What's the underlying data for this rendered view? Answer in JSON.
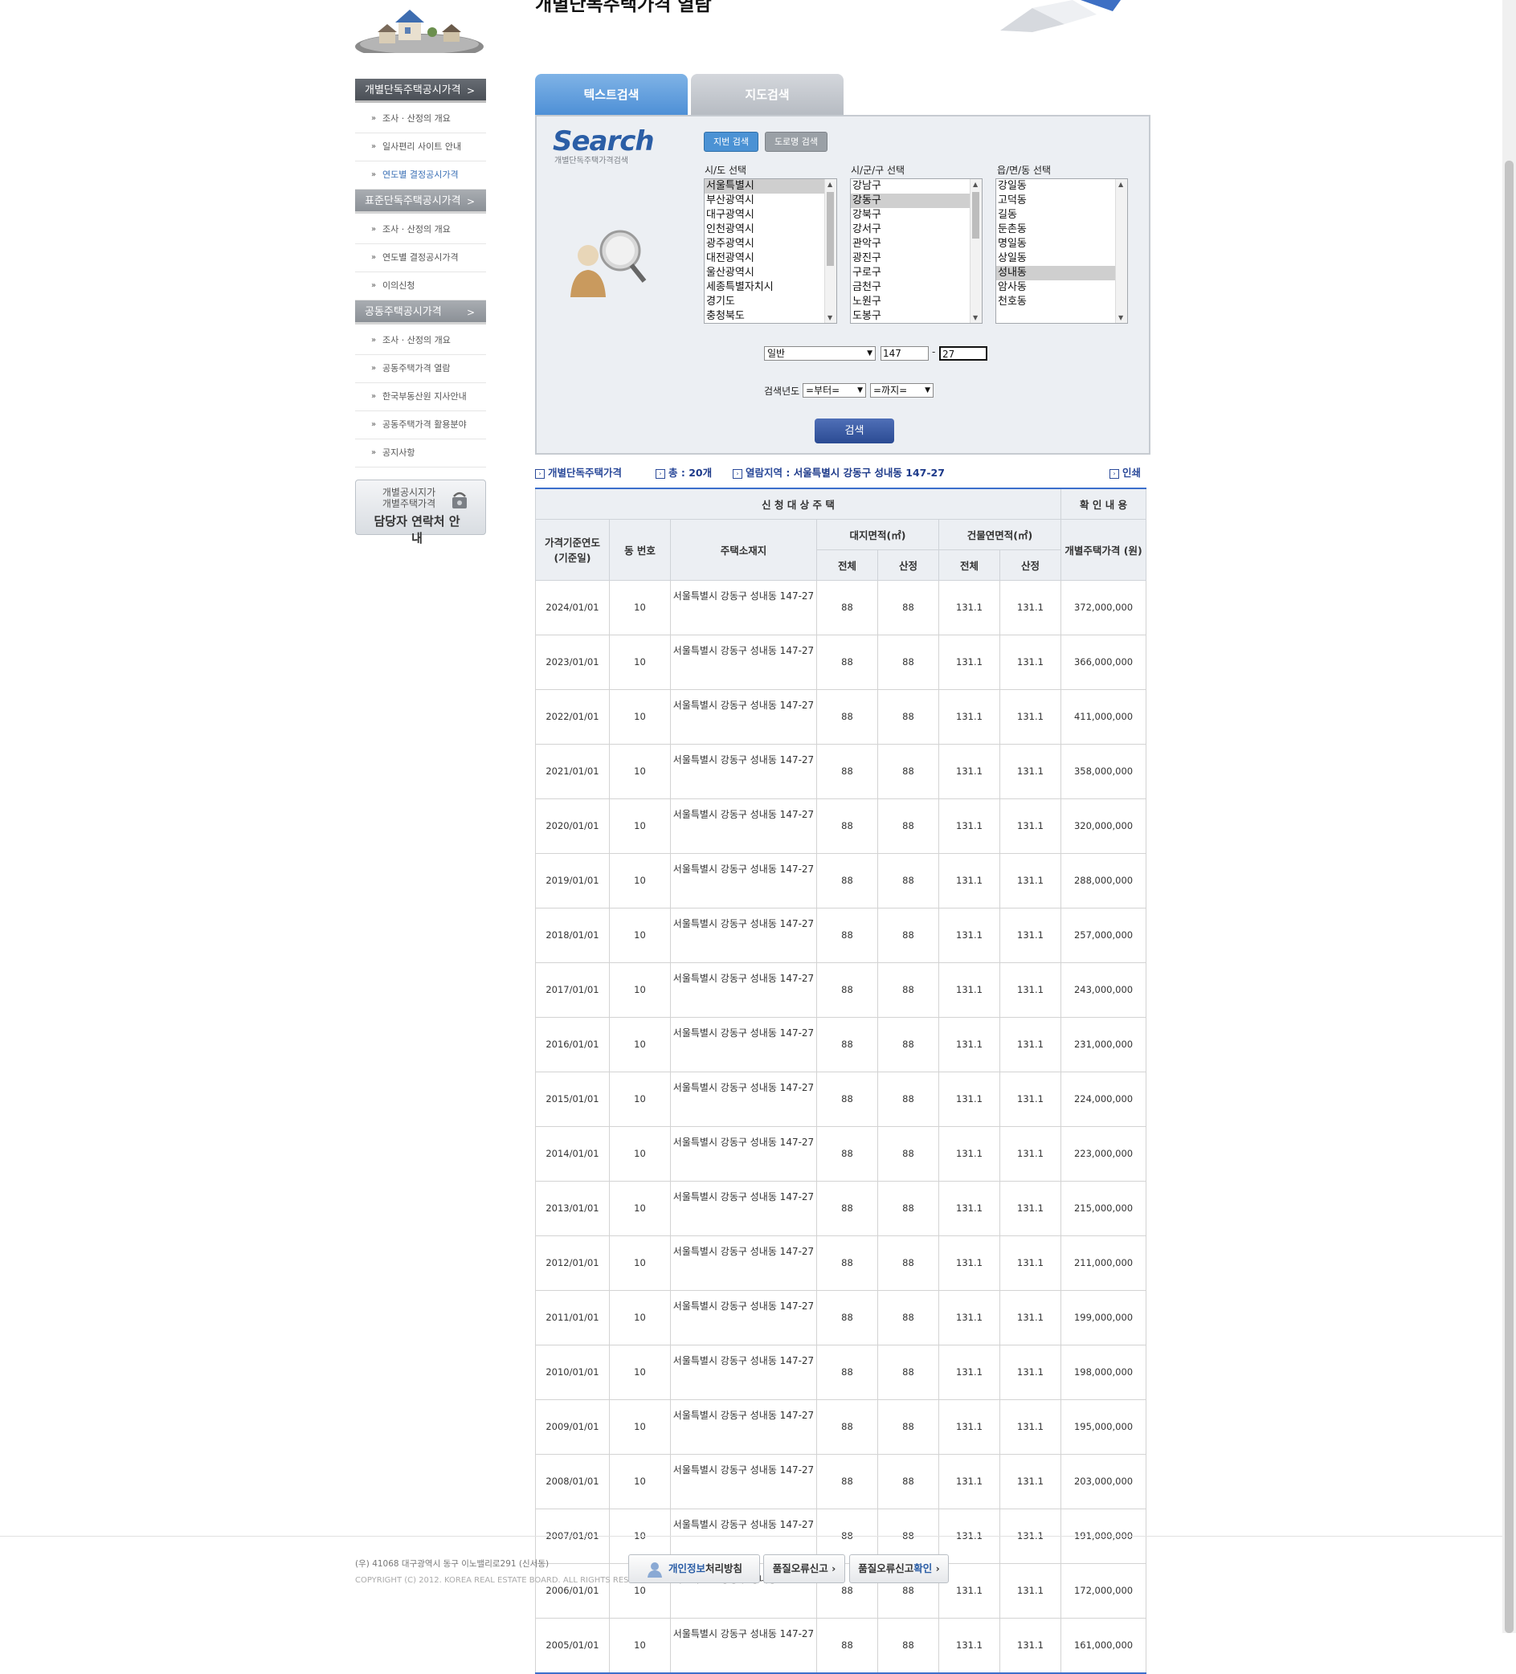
{
  "header": {
    "title": "개별단독주택가격 열람"
  },
  "lnb": {
    "groups": [
      {
        "title": "개별단독주택공시가격",
        "chev": ">",
        "items": [
          "조사 · 산정의 개요",
          "일사편리 사이트 안내",
          "연도별 결정공시가격"
        ]
      },
      {
        "title": "표준단독주택공시가격",
        "chev": ">",
        "items": [
          "조사 · 산정의 개요",
          "연도별 결정공시가격",
          "이의신청"
        ]
      },
      {
        "title": "공동주택공시가격",
        "chev": ">",
        "items": [
          "조사 · 산정의 개요",
          "공동주택가격 열람",
          "한국부동산원 지사안내",
          "공동주택가격 활용분야",
          "공지사항"
        ]
      }
    ],
    "bullet": "»",
    "contact": {
      "line1": "개별공시지가",
      "line2": "개별주택가격",
      "line3": "담당자 연락처 안내"
    }
  },
  "tabs": {
    "text_search": "텍스트검색",
    "map_search": "지도검색"
  },
  "search": {
    "logo": "Search",
    "logo_sub": "개별단독주택가격검색",
    "mode_jibun": "지번 검색",
    "mode_road": "도로명 검색",
    "sido_label": "시/도 선택",
    "sigungu_label": "시/군/구 선택",
    "eupmyeondong_label": "읍/면/동 선택",
    "sido_options": [
      "서울특별시",
      "부산광역시",
      "대구광역시",
      "인천광역시",
      "광주광역시",
      "대전광역시",
      "울산광역시",
      "세종특별자치시",
      "경기도",
      "충청북도"
    ],
    "sido_selected": 0,
    "sigungu_options": [
      "강남구",
      "강동구",
      "강북구",
      "강서구",
      "관악구",
      "광진구",
      "구로구",
      "금천구",
      "노원구",
      "도봉구"
    ],
    "sigungu_selected": 1,
    "dong_options": [
      "강일동",
      "고덕동",
      "길동",
      "둔촌동",
      "명일동",
      "상일동",
      "성내동",
      "암사동",
      "천호동"
    ],
    "dong_selected": 6,
    "land_type": "일반",
    "bunji_main": "147",
    "dash": "-",
    "bunji_sub": "27",
    "year_label": "검색년도",
    "year_from": "=부터=",
    "year_to": "=까지=",
    "search_button": "검색",
    "select_arrow": "▼",
    "scroll_up": "▲",
    "scroll_down": "▼"
  },
  "info": {
    "box": "›",
    "category": "개별단독주택가격",
    "total_label": "총 :",
    "total_value": "20개",
    "region_label": "열람지역 :",
    "region_value": "서울특별시 강동구 성내동 147-27",
    "print": "인쇄"
  },
  "table": {
    "group_target": "신 청 대 상 주 택",
    "group_confirm": "확 인 내 용",
    "h_year": "가격기준연도 (기준일)",
    "h_dong": "동 번호",
    "h_addr": "주택소재지",
    "h_land": "대지면적(㎡)",
    "h_bldg": "건물연면적(㎡)",
    "h_price": "개별주택가격 (원)",
    "h_total": "전체",
    "h_calc": "산정",
    "rows": [
      {
        "year": "2024/01/01",
        "dong": "10",
        "addr": "서울특별시 강동구 성내동 147-27",
        "land_total": "88",
        "land_calc": "88",
        "bldg_total": "131.1",
        "bldg_calc": "131.1",
        "price": "372,000,000"
      },
      {
        "year": "2023/01/01",
        "dong": "10",
        "addr": "서울특별시 강동구 성내동 147-27",
        "land_total": "88",
        "land_calc": "88",
        "bldg_total": "131.1",
        "bldg_calc": "131.1",
        "price": "366,000,000"
      },
      {
        "year": "2022/01/01",
        "dong": "10",
        "addr": "서울특별시 강동구 성내동 147-27",
        "land_total": "88",
        "land_calc": "88",
        "bldg_total": "131.1",
        "bldg_calc": "131.1",
        "price": "411,000,000"
      },
      {
        "year": "2021/01/01",
        "dong": "10",
        "addr": "서울특별시 강동구 성내동 147-27",
        "land_total": "88",
        "land_calc": "88",
        "bldg_total": "131.1",
        "bldg_calc": "131.1",
        "price": "358,000,000"
      },
      {
        "year": "2020/01/01",
        "dong": "10",
        "addr": "서울특별시 강동구 성내동 147-27",
        "land_total": "88",
        "land_calc": "88",
        "bldg_total": "131.1",
        "bldg_calc": "131.1",
        "price": "320,000,000"
      },
      {
        "year": "2019/01/01",
        "dong": "10",
        "addr": "서울특별시 강동구 성내동 147-27",
        "land_total": "88",
        "land_calc": "88",
        "bldg_total": "131.1",
        "bldg_calc": "131.1",
        "price": "288,000,000"
      },
      {
        "year": "2018/01/01",
        "dong": "10",
        "addr": "서울특별시 강동구 성내동 147-27",
        "land_total": "88",
        "land_calc": "88",
        "bldg_total": "131.1",
        "bldg_calc": "131.1",
        "price": "257,000,000"
      },
      {
        "year": "2017/01/01",
        "dong": "10",
        "addr": "서울특별시 강동구 성내동 147-27",
        "land_total": "88",
        "land_calc": "88",
        "bldg_total": "131.1",
        "bldg_calc": "131.1",
        "price": "243,000,000"
      },
      {
        "year": "2016/01/01",
        "dong": "10",
        "addr": "서울특별시 강동구 성내동 147-27",
        "land_total": "88",
        "land_calc": "88",
        "bldg_total": "131.1",
        "bldg_calc": "131.1",
        "price": "231,000,000"
      },
      {
        "year": "2015/01/01",
        "dong": "10",
        "addr": "서울특별시 강동구 성내동 147-27",
        "land_total": "88",
        "land_calc": "88",
        "bldg_total": "131.1",
        "bldg_calc": "131.1",
        "price": "224,000,000"
      },
      {
        "year": "2014/01/01",
        "dong": "10",
        "addr": "서울특별시 강동구 성내동 147-27",
        "land_total": "88",
        "land_calc": "88",
        "bldg_total": "131.1",
        "bldg_calc": "131.1",
        "price": "223,000,000"
      },
      {
        "year": "2013/01/01",
        "dong": "10",
        "addr": "서울특별시 강동구 성내동 147-27",
        "land_total": "88",
        "land_calc": "88",
        "bldg_total": "131.1",
        "bldg_calc": "131.1",
        "price": "215,000,000"
      },
      {
        "year": "2012/01/01",
        "dong": "10",
        "addr": "서울특별시 강동구 성내동 147-27",
        "land_total": "88",
        "land_calc": "88",
        "bldg_total": "131.1",
        "bldg_calc": "131.1",
        "price": "211,000,000"
      },
      {
        "year": "2011/01/01",
        "dong": "10",
        "addr": "서울특별시 강동구 성내동 147-27",
        "land_total": "88",
        "land_calc": "88",
        "bldg_total": "131.1",
        "bldg_calc": "131.1",
        "price": "199,000,000"
      },
      {
        "year": "2010/01/01",
        "dong": "10",
        "addr": "서울특별시 강동구 성내동 147-27",
        "land_total": "88",
        "land_calc": "88",
        "bldg_total": "131.1",
        "bldg_calc": "131.1",
        "price": "198,000,000"
      },
      {
        "year": "2009/01/01",
        "dong": "10",
        "addr": "서울특별시 강동구 성내동 147-27",
        "land_total": "88",
        "land_calc": "88",
        "bldg_total": "131.1",
        "bldg_calc": "131.1",
        "price": "195,000,000"
      },
      {
        "year": "2008/01/01",
        "dong": "10",
        "addr": "서울특별시 강동구 성내동 147-27",
        "land_total": "88",
        "land_calc": "88",
        "bldg_total": "131.1",
        "bldg_calc": "131.1",
        "price": "203,000,000"
      },
      {
        "year": "2007/01/01",
        "dong": "10",
        "addr": "서울특별시 강동구 성내동 147-27",
        "land_total": "88",
        "land_calc": "88",
        "bldg_total": "131.1",
        "bldg_calc": "131.1",
        "price": "191,000,000"
      },
      {
        "year": "2006/01/01",
        "dong": "10",
        "addr": "서울특별시 강동구 성내동 147-27",
        "land_total": "88",
        "land_calc": "88",
        "bldg_total": "131.1",
        "bldg_calc": "131.1",
        "price": "172,000,000"
      },
      {
        "year": "2005/01/01",
        "dong": "10",
        "addr": "서울특별시 강동구 성내동 147-27",
        "land_total": "88",
        "land_calc": "88",
        "bldg_total": "131.1",
        "bldg_calc": "131.1",
        "price": "161,000,000"
      }
    ]
  },
  "footer": {
    "address": "(우) 41068   대구광역시 동구 이노밸리로291 (신서동)",
    "copyright": "COPYRIGHT (C) 2012. KOREA REAL ESTATE BOARD. ALL RIGHTS RESERVED.",
    "privacy_a": "개인정보",
    "privacy_b": "처리방침",
    "report": "품질오류신고 ›",
    "check_a": "품질오류신고",
    "check_b": "확인",
    "check_c": " ›"
  }
}
